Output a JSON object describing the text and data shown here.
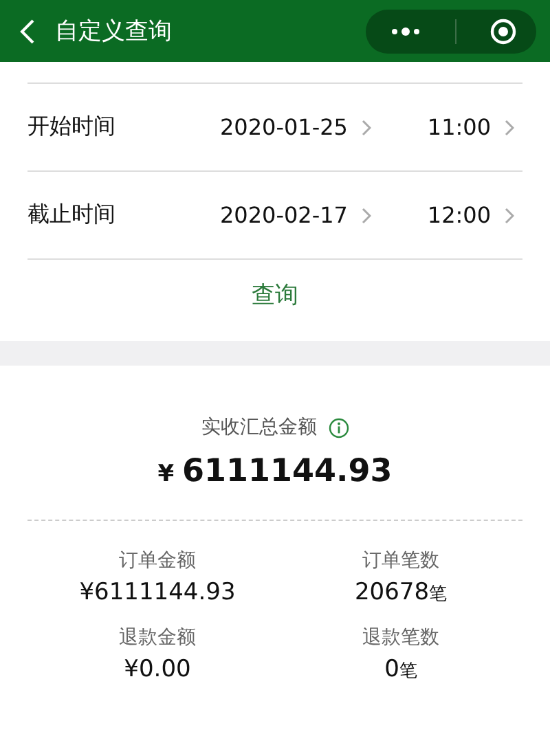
{
  "header": {
    "title": "自定义查询"
  },
  "rows": [
    {
      "label": "开始时间",
      "date": "2020-01-25",
      "time": "11:00"
    },
    {
      "label": "截止时间",
      "date": "2020-02-17",
      "time": "12:00"
    }
  ],
  "query_button": "查询",
  "summary": {
    "title": "实收汇总金额",
    "currency": "¥",
    "total": "6111144.93"
  },
  "stats": [
    {
      "label": "订单金额",
      "value": "¥6111144.93"
    },
    {
      "label": "订单笔数",
      "value": "20678",
      "unit": "笔"
    },
    {
      "label": "退款金额",
      "value": "¥0.00"
    },
    {
      "label": "退款笔数",
      "value": "0",
      "unit": "笔"
    }
  ]
}
